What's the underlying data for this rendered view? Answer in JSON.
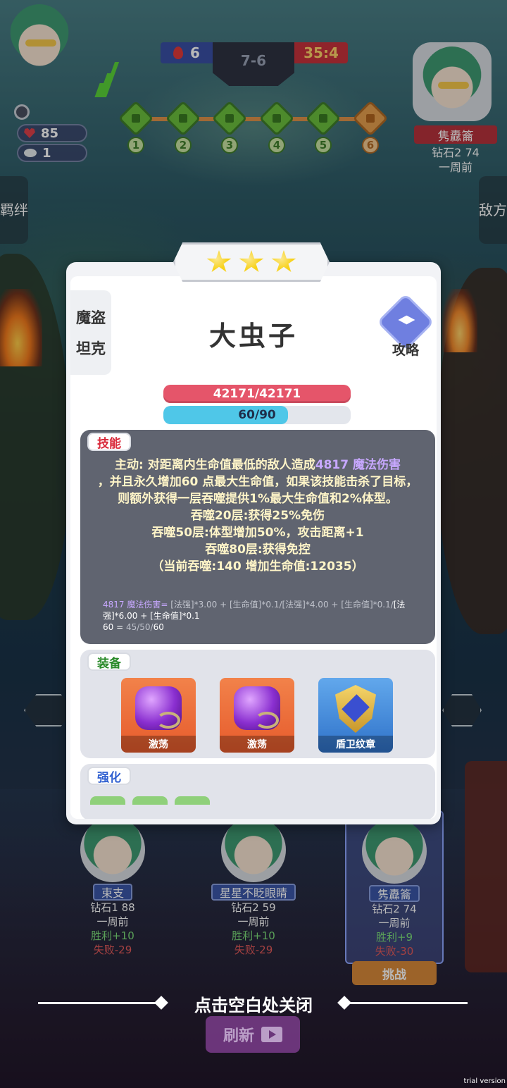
{
  "hud": {
    "health": "85",
    "coins": "1",
    "score_left": "6",
    "round": "7-6",
    "score_right": "35:4",
    "rounds": [
      "1",
      "2",
      "3",
      "4",
      "5",
      "6"
    ],
    "opponent": {
      "name": "隽纛籥",
      "rank": "钻石2 74",
      "time": "一周前"
    },
    "side_left": "羁绊",
    "side_right": "敌方"
  },
  "modal": {
    "stars": 3,
    "traits": [
      "魔盗",
      "坦克"
    ],
    "unit_name": "大虫子",
    "guide_label": "攻略",
    "hp_text": "42171/42171",
    "mp_text": "60/90",
    "mp_fraction": 0.667,
    "skill": {
      "tag": "技能",
      "l1a": "主动: 对距离内生命值最低的敌人造成",
      "l1b": "4817 魔法伤害",
      "l2": "，并且永久增加60 点最大生命值，如果该技能击杀了目标，则额外获得一层吞噬提供1%最大生命值和2%体型。",
      "l3": "吞噬20层:获得25%免伤",
      "l4": "吞噬50层:体型增加50%，攻击距离+1",
      "l5": "吞噬80层:获得免控",
      "l6": "（当前吞噬:140 增加生命值:12035）",
      "f1a": "4817 魔法伤害= ",
      "f1b": "[法强]*3.00 + [生命值]*0.1/[法强]*4.00 + [生命值]*0.1/",
      "f1c": "[法强]*6.00 + [生命值]*0.1",
      "f2a": "60 = ",
      "f2b": "45/50/",
      "f2c": "60"
    },
    "equip": {
      "tag": "装备",
      "items": [
        "激荡",
        "激荡",
        "盾卫纹章"
      ]
    },
    "enhance": {
      "tag": "强化"
    }
  },
  "players": [
    {
      "name": "束支",
      "rank": "钻石1 88",
      "time": "一周前",
      "win": "胜利+10",
      "lose": "失败-29"
    },
    {
      "name": "星星不眨眼睛",
      "rank": "钻石2 59",
      "time": "一周前",
      "win": "胜利+10",
      "lose": "失败-29"
    },
    {
      "name": "隽纛籥",
      "rank": "钻石2 74",
      "time": "一周前",
      "win": "胜利+9",
      "lose": "失败-30"
    }
  ],
  "challenge_label": "挑战",
  "close_hint": "点击空白处关闭",
  "refresh_label": "刷新",
  "trial_label": "trial version"
}
